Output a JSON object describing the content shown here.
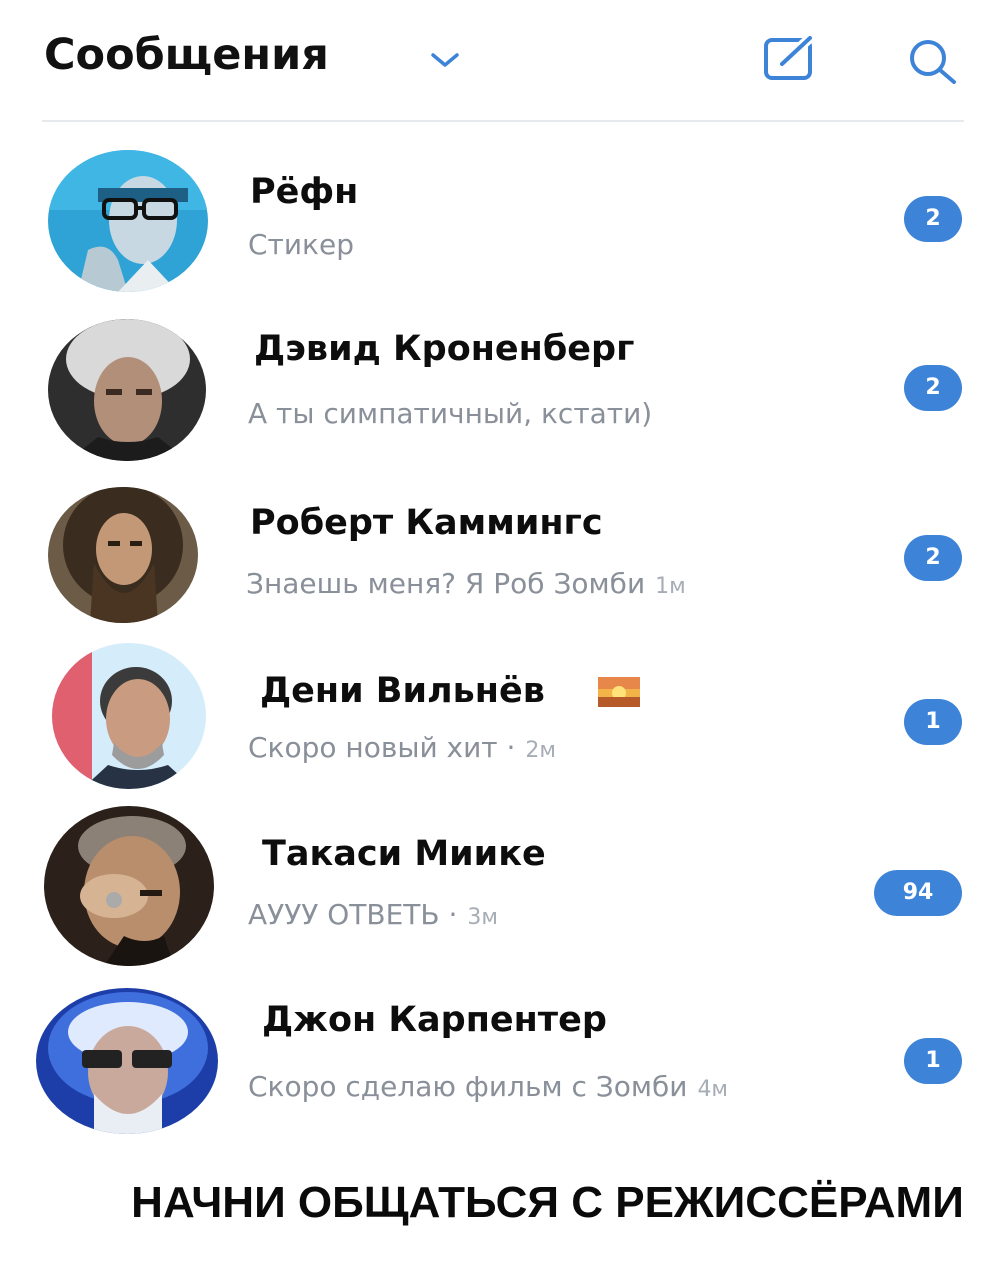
{
  "header": {
    "title": "Сообщения",
    "chevron_icon": "chevron-down-icon",
    "compose_icon": "compose-icon",
    "search_icon": "search-icon",
    "accent": "#3d84d8"
  },
  "conversations": [
    {
      "name": "Рёфн",
      "preview": "Стикер",
      "time": "",
      "unread": "2"
    },
    {
      "name": "Дэвид Кроненберг",
      "preview": "А ты симпатичный, кстати)",
      "time": "",
      "unread": "2"
    },
    {
      "name": "Роберт Каммингс",
      "preview": "Знаешь меня? Я Роб Зомби",
      "time": "1м",
      "unread": "2"
    },
    {
      "name": "Дени Вильнёв",
      "preview": "Скоро новый хит ·",
      "time": "2м",
      "unread": "1",
      "emoji": "sunset-image-icon"
    },
    {
      "name": "Такаси Миике",
      "preview": "АУУУ ОТВЕТЬ ·",
      "time": "3м",
      "unread": "94"
    },
    {
      "name": "Джон Карпентер",
      "preview": "Скоро сделаю фильм с Зомби",
      "time": "4м",
      "unread": "1"
    }
  ],
  "caption": "НАЧНИ ОБЩАТЬСЯ С РЕЖИССЁРАМИ"
}
